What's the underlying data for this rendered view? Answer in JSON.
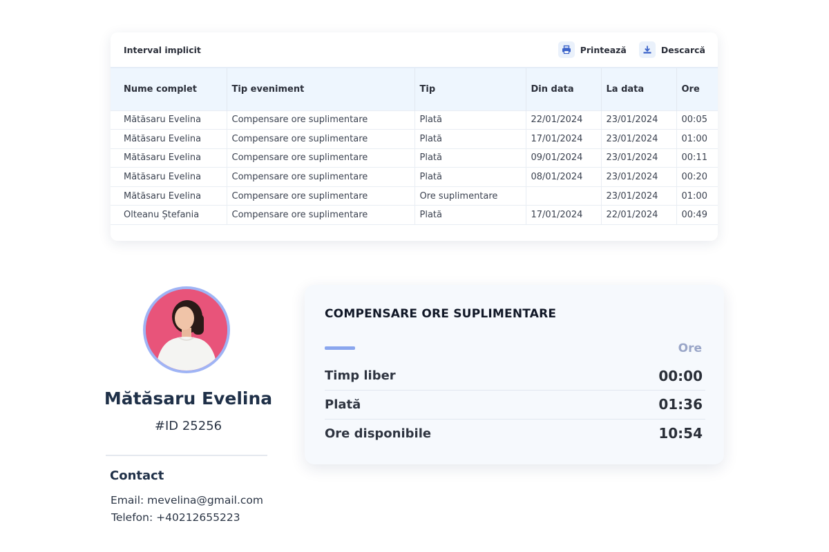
{
  "table_card": {
    "title": "Interval implicit",
    "print_label": "Printează",
    "download_label": "Descarcă",
    "columns": [
      "Nume complet",
      "Tip eveniment",
      "Tip",
      "Din data",
      "La data",
      "Ore"
    ],
    "rows": [
      [
        "Mătăsaru Evelina",
        "Compensare ore suplimentare",
        "Plată",
        "22/01/2024",
        "23/01/2024",
        "00:05"
      ],
      [
        "Mătăsaru Evelina",
        "Compensare ore suplimentare",
        "Plată",
        "17/01/2024",
        "23/01/2024",
        "01:00"
      ],
      [
        "Mătăsaru Evelina",
        "Compensare ore suplimentare",
        "Plată",
        "09/01/2024",
        "23/01/2024",
        "00:11"
      ],
      [
        "Mătăsaru Evelina",
        "Compensare ore suplimentare",
        "Plată",
        "08/01/2024",
        "23/01/2024",
        "00:20"
      ],
      [
        "Mătăsaru Evelina",
        "Compensare ore suplimentare",
        "Ore suplimentare",
        "",
        "23/01/2024",
        "01:00"
      ],
      [
        "Olteanu Ștefania",
        "Compensare ore suplimentare",
        "Plată",
        "17/01/2024",
        "22/01/2024",
        "00:49"
      ]
    ]
  },
  "profile": {
    "name": "Mătăsaru Evelina",
    "id_label": "#ID 25256",
    "contact_heading": "Contact",
    "email_line": "Email: mevelina@gmail.com",
    "phone_line": "Telefon: +40212655223"
  },
  "summary": {
    "title": "COMPENSARE ORE SUPLIMENTARE",
    "column_header": "Ore",
    "rows": [
      {
        "label": "Timp liber",
        "value": "00:00"
      },
      {
        "label": "Plată",
        "value": "01:36"
      },
      {
        "label": "Ore disponibile",
        "value": "10:54"
      }
    ]
  },
  "colors": {
    "accent": "#8aa6ee",
    "icon_blue": "#3b63c9",
    "header_bg": "#eef6fe",
    "avatar_bg": "#e8547a"
  },
  "icons": {
    "print": "printer-icon",
    "download": "download-icon"
  }
}
